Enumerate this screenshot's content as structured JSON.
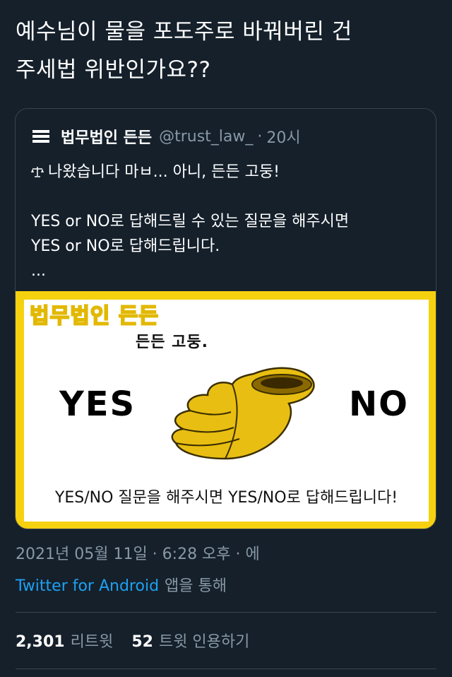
{
  "tweet": {
    "text_line1": "예수님이 물을 포도주로 바꿔버린 건",
    "text_line2": "주세법 위반인가요??"
  },
  "quote": {
    "name": "법무법인 든든",
    "handle": "@trust_law_",
    "separator": "·",
    "time": "20시",
    "lines": [
      "나왔습니다 마ㅂ... 아니, 든든 고둥!",
      "",
      "YES or NO로 답해드릴 수 있는 질문을 해주시면",
      "YES or NO로 답해드립니다.",
      "..."
    ],
    "image": {
      "logo_text": "법무법인 든든",
      "subtitle": "든든 고둥.",
      "yes_label": "YES",
      "no_label": "NO",
      "caption": "YES/NO 질문을 해주시면 YES/NO로 답해드립니다!",
      "border_color": "#f5d10f",
      "shell_color": "#e8be12"
    }
  },
  "meta": {
    "date": "2021년 05월 11일 · 6:28 오후 · 에",
    "source_link": "Twitter for Android",
    "source_suffix": "앱을 통해"
  },
  "stats": {
    "retweets": "2,301",
    "retweets_label": "리트윗",
    "quotes": "52",
    "quotes_label": "트윗 인용하기"
  },
  "colors": {
    "background": "#15202b",
    "secondary_text": "#8899a6",
    "link": "#1da1f2",
    "border": "#38444d"
  }
}
